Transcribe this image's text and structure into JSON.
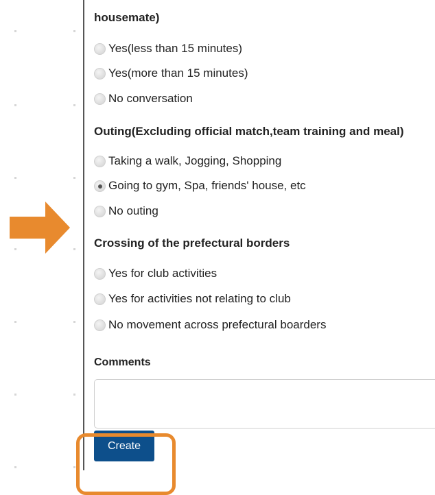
{
  "form": {
    "conversation_heading_tail": "housemate)",
    "conversation_options": [
      {
        "label": "Yes(less than 15 minutes)",
        "checked": false
      },
      {
        "label": "Yes(more than 15 minutes)",
        "checked": false
      },
      {
        "label": "No conversation",
        "checked": false
      }
    ],
    "outing_heading": "Outing(Excluding official match,team training and meal)",
    "outing_options": [
      {
        "label": "Taking a walk, Jogging, Shopping",
        "checked": false
      },
      {
        "label": "Going to gym, Spa, friends' house, etc",
        "checked": true
      },
      {
        "label": "No outing",
        "checked": false
      }
    ],
    "border_heading": "Crossing of the prefectural borders",
    "border_options": [
      {
        "label": "Yes for club activities",
        "checked": false
      },
      {
        "label": "Yes for activities not relating to club",
        "checked": false
      },
      {
        "label": "No movement across prefectural boarders",
        "checked": false
      }
    ],
    "comments_label": "Comments",
    "comments_value": "",
    "create_label": "Create"
  },
  "annotation": {
    "arrow_color": "#e88a2e",
    "highlight_color": "#e88a2e"
  },
  "colors": {
    "button_bg": "#0d4f8b",
    "panel_border": "#555555"
  }
}
